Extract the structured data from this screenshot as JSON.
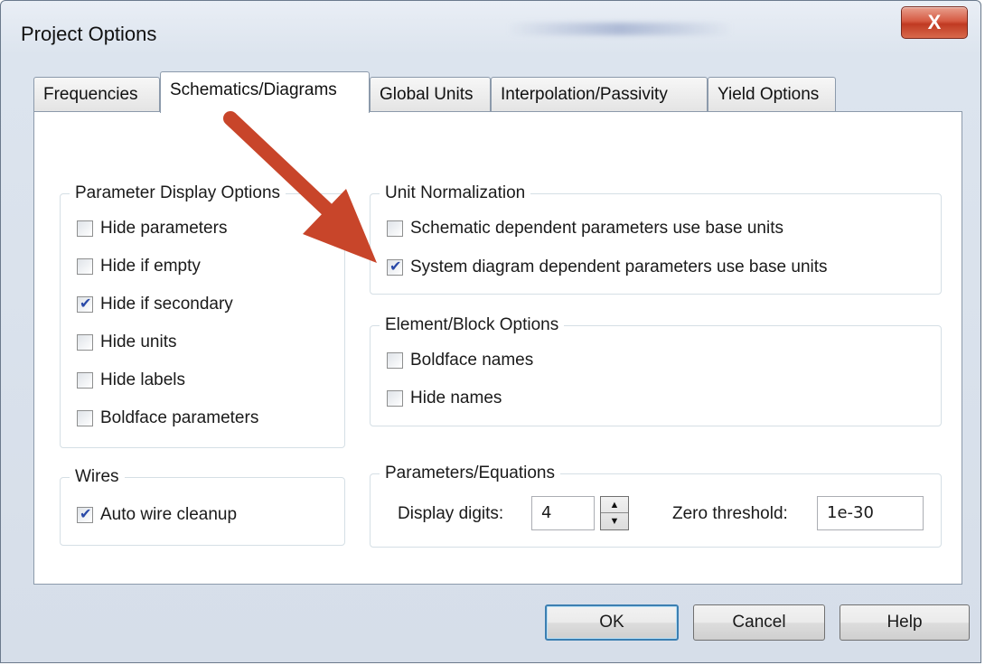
{
  "window": {
    "title": "Project Options",
    "close_symbol": "X"
  },
  "tabs": [
    {
      "label": "Frequencies",
      "active": false
    },
    {
      "label": "Schematics/Diagrams",
      "active": true
    },
    {
      "label": "Global Units",
      "active": false
    },
    {
      "label": "Interpolation/Passivity",
      "active": false
    },
    {
      "label": "Yield Options",
      "active": false
    }
  ],
  "param_display": {
    "title": "Parameter Display Options",
    "items": [
      {
        "label": "Hide parameters",
        "checked": false
      },
      {
        "label": "Hide if empty",
        "checked": false
      },
      {
        "label": "Hide if secondary",
        "checked": true
      },
      {
        "label": "Hide units",
        "checked": false
      },
      {
        "label": "Hide labels",
        "checked": false
      },
      {
        "label": "Boldface parameters",
        "checked": false
      }
    ]
  },
  "wires": {
    "title": "Wires",
    "items": [
      {
        "label": "Auto wire cleanup",
        "checked": true
      }
    ]
  },
  "unit_norm": {
    "title": "Unit Normalization",
    "items": [
      {
        "label": "Schematic dependent parameters use base units",
        "checked": false
      },
      {
        "label": "System diagram dependent parameters use base units",
        "checked": true
      }
    ]
  },
  "element_block": {
    "title": "Element/Block Options",
    "items": [
      {
        "label": "Boldface names",
        "checked": false
      },
      {
        "label": "Hide names",
        "checked": false
      }
    ]
  },
  "params_eq": {
    "title": "Parameters/Equations",
    "display_digits_label": "Display digits:",
    "display_digits_value": "4",
    "zero_threshold_label": "Zero threshold:",
    "zero_threshold_value": "1e-30"
  },
  "buttons": {
    "ok": "OK",
    "cancel": "Cancel",
    "help": "Help"
  },
  "colors": {
    "arrow": "#c8452a",
    "close_button": "#c8432a",
    "check": "#2a4aa8"
  }
}
